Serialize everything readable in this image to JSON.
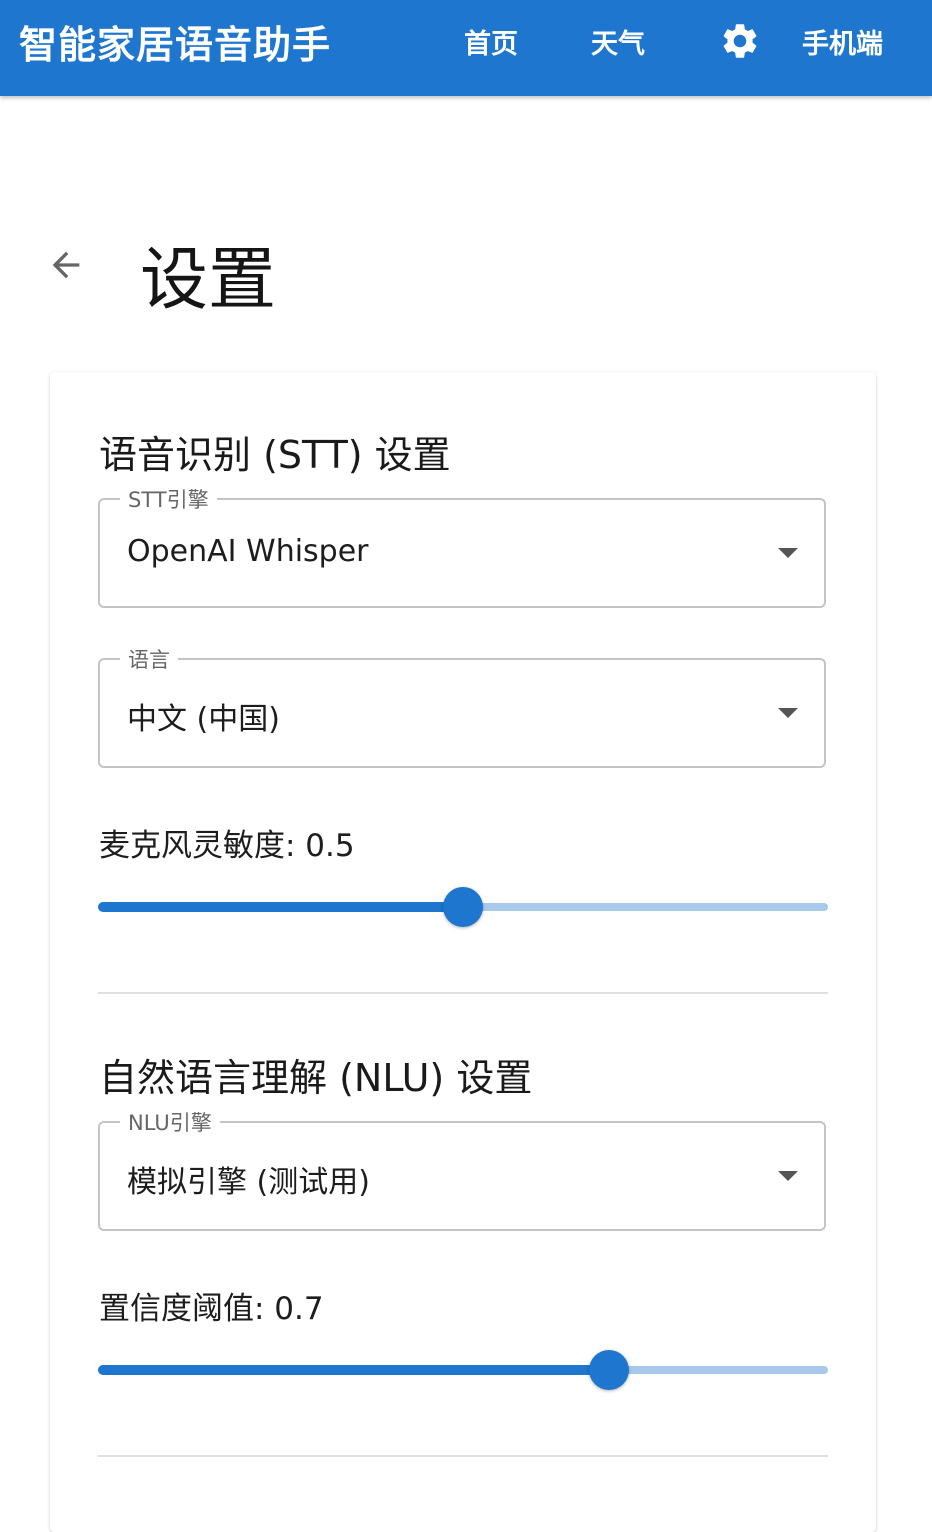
{
  "appbar": {
    "title": "智能家居语音助手",
    "nav": {
      "home": "首页",
      "weather": "天气",
      "mobile": "手机端"
    },
    "accent": "#1e76cf"
  },
  "page": {
    "title": "设置"
  },
  "stt": {
    "section_title": "语音识别 (STT) 设置",
    "engine_label": "STT引擎",
    "engine_value": "OpenAI Whisper",
    "language_label": "语言",
    "language_value": "中文 (中国)",
    "sensitivity_label": "麦克风灵敏度: 0.5",
    "sensitivity_value": 0.5
  },
  "nlu": {
    "section_title": "自然语言理解 (NLU) 设置",
    "engine_label": "NLU引擎",
    "engine_value": "模拟引擎 (测试用)",
    "confidence_label": "置信度阈值: 0.7",
    "confidence_value": 0.7
  }
}
